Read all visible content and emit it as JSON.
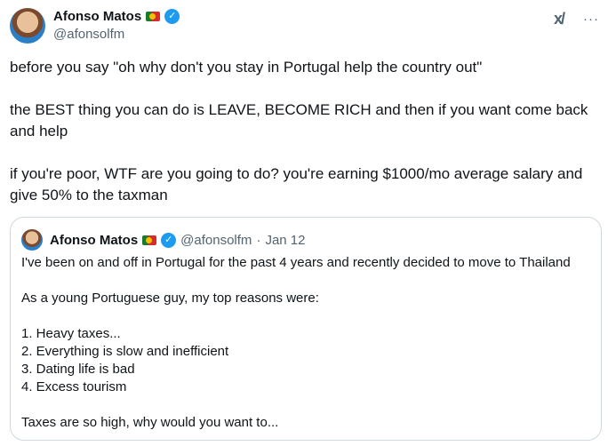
{
  "author": {
    "display_name": "Afonso Matos",
    "handle": "@afonsolfm",
    "verified_icon": "✓"
  },
  "icons": {
    "grok": "x/",
    "more": "···"
  },
  "tweet": {
    "text": "before you say \"oh why don't you stay in Portugal help the country out\"\n\nthe BEST thing you can do is LEAVE, BECOME RICH and then if you want come back and help\n\nif you're poor, WTF are you going to do? you're earning $1000/mo average salary and give 50% to the taxman"
  },
  "quote": {
    "display_name": "Afonso Matos",
    "handle": "@afonsolfm",
    "separator": "·",
    "date": "Jan 12",
    "text": "I've been on and off in Portugal for the past 4 years and recently decided to move to Thailand\n\nAs a young Portuguese guy, my top reasons were:\n\n1. Heavy taxes...\n2. Everything is slow and inefficient\n3. Dating life is bad\n4. Excess tourism\n\nTaxes are so high, why would you want to..."
  },
  "colors": {
    "verified": "#1d9bf0",
    "muted": "#536471",
    "border": "#cfd9de"
  }
}
